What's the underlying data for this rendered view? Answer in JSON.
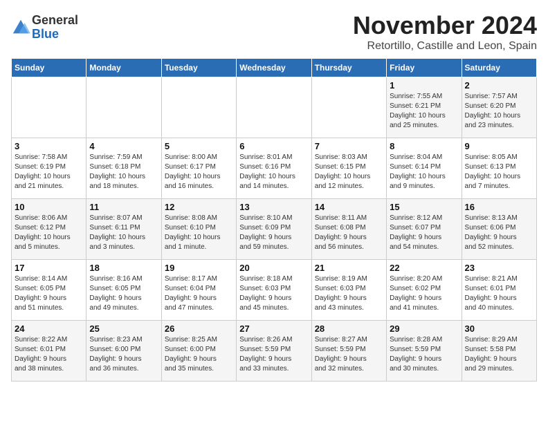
{
  "logo": {
    "general": "General",
    "blue": "Blue"
  },
  "title": "November 2024",
  "location": "Retortillo, Castille and Leon, Spain",
  "days_of_week": [
    "Sunday",
    "Monday",
    "Tuesday",
    "Wednesday",
    "Thursday",
    "Friday",
    "Saturday"
  ],
  "weeks": [
    [
      {
        "day": "",
        "info": ""
      },
      {
        "day": "",
        "info": ""
      },
      {
        "day": "",
        "info": ""
      },
      {
        "day": "",
        "info": ""
      },
      {
        "day": "",
        "info": ""
      },
      {
        "day": "1",
        "info": "Sunrise: 7:55 AM\nSunset: 6:21 PM\nDaylight: 10 hours\nand 25 minutes."
      },
      {
        "day": "2",
        "info": "Sunrise: 7:57 AM\nSunset: 6:20 PM\nDaylight: 10 hours\nand 23 minutes."
      }
    ],
    [
      {
        "day": "3",
        "info": "Sunrise: 7:58 AM\nSunset: 6:19 PM\nDaylight: 10 hours\nand 21 minutes."
      },
      {
        "day": "4",
        "info": "Sunrise: 7:59 AM\nSunset: 6:18 PM\nDaylight: 10 hours\nand 18 minutes."
      },
      {
        "day": "5",
        "info": "Sunrise: 8:00 AM\nSunset: 6:17 PM\nDaylight: 10 hours\nand 16 minutes."
      },
      {
        "day": "6",
        "info": "Sunrise: 8:01 AM\nSunset: 6:16 PM\nDaylight: 10 hours\nand 14 minutes."
      },
      {
        "day": "7",
        "info": "Sunrise: 8:03 AM\nSunset: 6:15 PM\nDaylight: 10 hours\nand 12 minutes."
      },
      {
        "day": "8",
        "info": "Sunrise: 8:04 AM\nSunset: 6:14 PM\nDaylight: 10 hours\nand 9 minutes."
      },
      {
        "day": "9",
        "info": "Sunrise: 8:05 AM\nSunset: 6:13 PM\nDaylight: 10 hours\nand 7 minutes."
      }
    ],
    [
      {
        "day": "10",
        "info": "Sunrise: 8:06 AM\nSunset: 6:12 PM\nDaylight: 10 hours\nand 5 minutes."
      },
      {
        "day": "11",
        "info": "Sunrise: 8:07 AM\nSunset: 6:11 PM\nDaylight: 10 hours\nand 3 minutes."
      },
      {
        "day": "12",
        "info": "Sunrise: 8:08 AM\nSunset: 6:10 PM\nDaylight: 10 hours\nand 1 minute."
      },
      {
        "day": "13",
        "info": "Sunrise: 8:10 AM\nSunset: 6:09 PM\nDaylight: 9 hours\nand 59 minutes."
      },
      {
        "day": "14",
        "info": "Sunrise: 8:11 AM\nSunset: 6:08 PM\nDaylight: 9 hours\nand 56 minutes."
      },
      {
        "day": "15",
        "info": "Sunrise: 8:12 AM\nSunset: 6:07 PM\nDaylight: 9 hours\nand 54 minutes."
      },
      {
        "day": "16",
        "info": "Sunrise: 8:13 AM\nSunset: 6:06 PM\nDaylight: 9 hours\nand 52 minutes."
      }
    ],
    [
      {
        "day": "17",
        "info": "Sunrise: 8:14 AM\nSunset: 6:05 PM\nDaylight: 9 hours\nand 51 minutes."
      },
      {
        "day": "18",
        "info": "Sunrise: 8:16 AM\nSunset: 6:05 PM\nDaylight: 9 hours\nand 49 minutes."
      },
      {
        "day": "19",
        "info": "Sunrise: 8:17 AM\nSunset: 6:04 PM\nDaylight: 9 hours\nand 47 minutes."
      },
      {
        "day": "20",
        "info": "Sunrise: 8:18 AM\nSunset: 6:03 PM\nDaylight: 9 hours\nand 45 minutes."
      },
      {
        "day": "21",
        "info": "Sunrise: 8:19 AM\nSunset: 6:03 PM\nDaylight: 9 hours\nand 43 minutes."
      },
      {
        "day": "22",
        "info": "Sunrise: 8:20 AM\nSunset: 6:02 PM\nDaylight: 9 hours\nand 41 minutes."
      },
      {
        "day": "23",
        "info": "Sunrise: 8:21 AM\nSunset: 6:01 PM\nDaylight: 9 hours\nand 40 minutes."
      }
    ],
    [
      {
        "day": "24",
        "info": "Sunrise: 8:22 AM\nSunset: 6:01 PM\nDaylight: 9 hours\nand 38 minutes."
      },
      {
        "day": "25",
        "info": "Sunrise: 8:23 AM\nSunset: 6:00 PM\nDaylight: 9 hours\nand 36 minutes."
      },
      {
        "day": "26",
        "info": "Sunrise: 8:25 AM\nSunset: 6:00 PM\nDaylight: 9 hours\nand 35 minutes."
      },
      {
        "day": "27",
        "info": "Sunrise: 8:26 AM\nSunset: 5:59 PM\nDaylight: 9 hours\nand 33 minutes."
      },
      {
        "day": "28",
        "info": "Sunrise: 8:27 AM\nSunset: 5:59 PM\nDaylight: 9 hours\nand 32 minutes."
      },
      {
        "day": "29",
        "info": "Sunrise: 8:28 AM\nSunset: 5:59 PM\nDaylight: 9 hours\nand 30 minutes."
      },
      {
        "day": "30",
        "info": "Sunrise: 8:29 AM\nSunset: 5:58 PM\nDaylight: 9 hours\nand 29 minutes."
      }
    ]
  ]
}
